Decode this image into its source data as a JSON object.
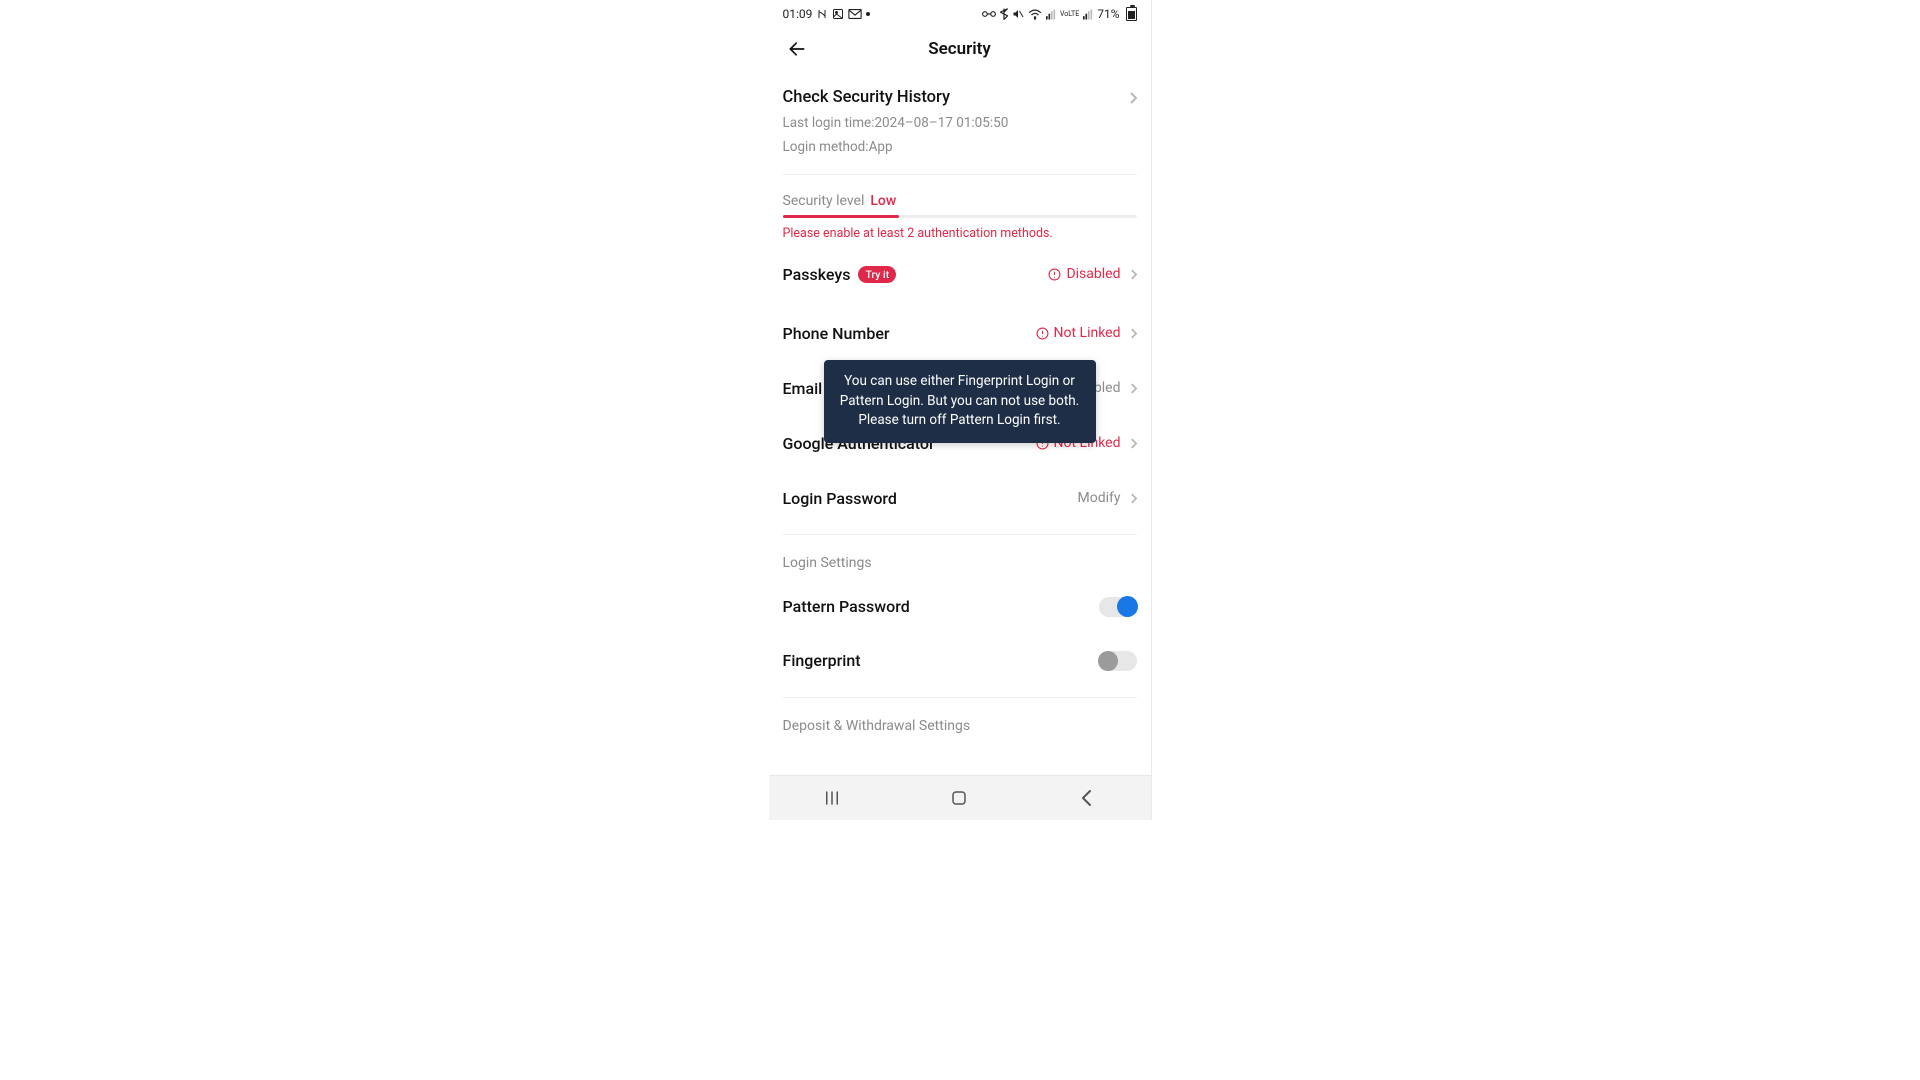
{
  "statusbar": {
    "time": "01:09",
    "battery_text": "71%"
  },
  "header": {
    "title": "Security"
  },
  "history": {
    "title": "Check Security History",
    "last_login": "Last login time:2024–08–17 01:05:50",
    "login_method": "Login method:App"
  },
  "security_level": {
    "label": "Security level",
    "value": "Low",
    "hint": "Please enable at least 2 authentication methods."
  },
  "items": {
    "passkeys": {
      "title": "Passkeys",
      "badge": "Try it",
      "status": "Disabled"
    },
    "phone": {
      "title": "Phone Number",
      "status": "Not Linked"
    },
    "email": {
      "title": "Email",
      "status": "abled"
    },
    "gauth": {
      "title": "Google Authenticator",
      "status": "Not Linked"
    },
    "password": {
      "title": "Login Password",
      "status": "Modify"
    }
  },
  "login_settings": {
    "label": "Login Settings",
    "pattern": {
      "title": "Pattern Password",
      "on": true
    },
    "fingerprint": {
      "title": "Fingerprint",
      "on": false
    }
  },
  "deposit_withdrawal": {
    "label": "Deposit & Withdrawal Settings"
  },
  "toast": {
    "text": "You can use either Fingerprint Login or Pattern Login. But you can not use both. Please turn off Pattern Login first."
  }
}
